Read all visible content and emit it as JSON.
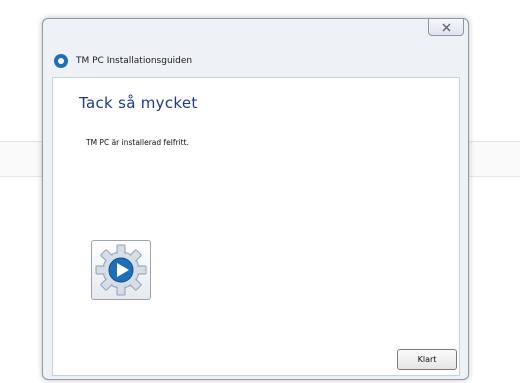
{
  "window": {
    "title": "TM PC Installationsguiden",
    "close_glyph": "✕"
  },
  "content": {
    "heading": "Tack så mycket",
    "message": "TM PC är installerad felfritt."
  },
  "footer": {
    "finish_label": "Klart"
  },
  "icons": {
    "app": "app-logo-icon",
    "setup": "gear-play-icon",
    "close": "close-icon"
  },
  "colors": {
    "heading": "#1e3a8a",
    "accent": "#1f6fb8"
  }
}
